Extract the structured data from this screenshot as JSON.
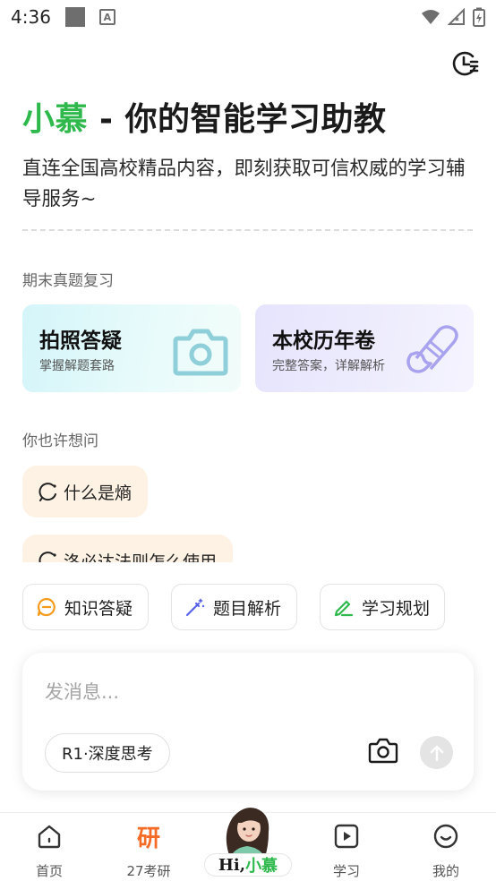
{
  "status_bar": {
    "time": "4:36"
  },
  "header": {
    "brand": "小慕",
    "title_rest": " - 你的智能学习助教",
    "subtitle": "直连全国高校精品内容，即刻获取可信权威的学习辅导服务~"
  },
  "exam_section": {
    "label": "期末真题复习",
    "cards": [
      {
        "title": "拍照答疑",
        "subtitle": "掌握解题套路",
        "icon": "camera-icon"
      },
      {
        "title": "本校历年卷",
        "subtitle": "完整答案，详解解析",
        "icon": "scroll-icon"
      }
    ]
  },
  "suggest_section": {
    "label": "你也许想问",
    "items": [
      {
        "text": "什么是熵"
      },
      {
        "text": "洛必达法则怎么使用"
      }
    ]
  },
  "quick_actions": [
    {
      "label": "知识答疑",
      "icon": "chat-bubble-icon"
    },
    {
      "label": "题目解析",
      "icon": "magic-wand-icon"
    },
    {
      "label": "学习规划",
      "icon": "pencil-icon"
    }
  ],
  "composer": {
    "placeholder": "发消息...",
    "mode_label": "R1·深度思考"
  },
  "tab_bar": {
    "items": [
      {
        "label": "首页",
        "icon": "home-icon"
      },
      {
        "label": "27考研",
        "glyph": "研"
      },
      {
        "label": "学习",
        "icon": "play-icon"
      },
      {
        "label": "我的",
        "icon": "smile-icon"
      }
    ],
    "center": {
      "hi": "Hi",
      "sep": ",",
      "name": "小慕"
    }
  },
  "colors": {
    "brand_green": "#2fb94c",
    "kaoyan_orange": "#f46b26",
    "suggestion_bg": "#fdf2e4"
  }
}
